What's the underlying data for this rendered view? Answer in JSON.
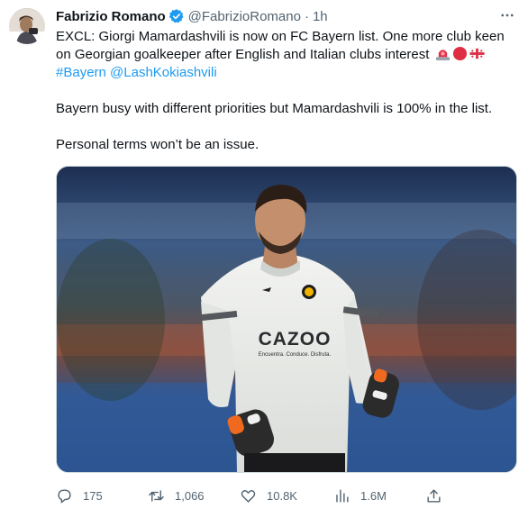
{
  "author": {
    "display_name": "Fabrizio Romano",
    "handle": "@FabrizioRomano",
    "separator": "·",
    "time": "1h",
    "verified_color": "#1d9bf0"
  },
  "tweet": {
    "line1": "EXCL: Giorgi Mamardashvili is now on FC Bayern list. One more club keen on Georgian goalkeeper after English and Italian clubs interest",
    "hashtag": "#Bayern",
    "mention": "@LashKokiashvili",
    "paragraph2": "Bayern busy with different priorities but Mamardashvili is 100% in the list.",
    "paragraph3": "Personal terms won’t be an issue.",
    "emojis": [
      "siren-emoji",
      "red-circle-emoji",
      "georgia-flag-emoji"
    ]
  },
  "media": {
    "jersey_sponsor": "CAZOO",
    "jersey_tagline": "Encuentra. Conduce. Disfruta."
  },
  "actions": {
    "replies": "175",
    "retweets": "1,066",
    "likes": "10.8K",
    "views": "1.6M"
  },
  "colors": {
    "accent": "#1d9bf0",
    "secondary_text": "#536471",
    "primary_text": "#0f1419"
  }
}
